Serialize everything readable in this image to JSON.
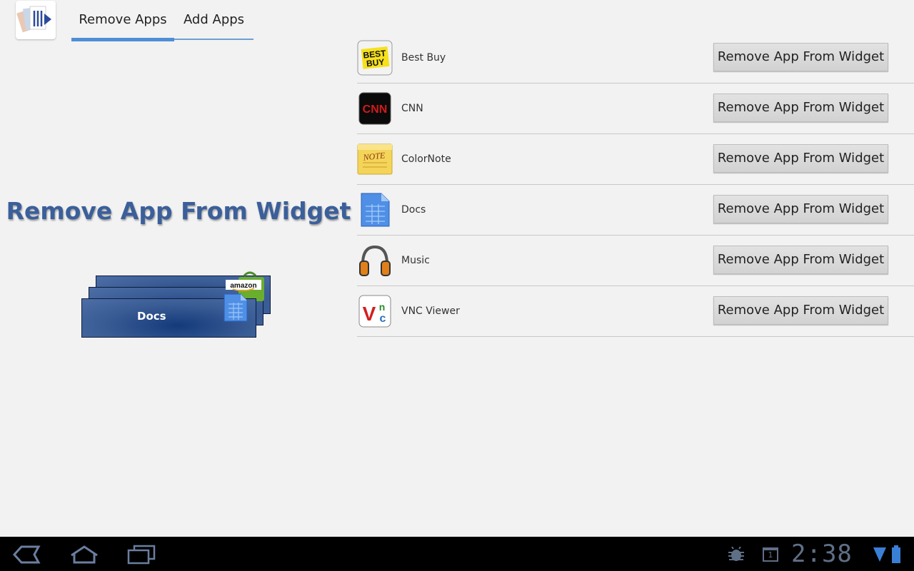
{
  "tabs": [
    {
      "label": "Remove Apps",
      "active": true
    },
    {
      "label": "Add Apps",
      "active": false
    }
  ],
  "promo": {
    "title": "Remove App From Widget",
    "card_label": "Docs",
    "mini_logo_text": "amazon"
  },
  "apps": [
    {
      "name": "Best Buy",
      "icon": "best-buy-icon",
      "button": "Remove App From Widget"
    },
    {
      "name": "CNN",
      "icon": "cnn-icon",
      "button": "Remove App From Widget"
    },
    {
      "name": "ColorNote",
      "icon": "colornote-icon",
      "button": "Remove App From Widget"
    },
    {
      "name": "Docs",
      "icon": "docs-icon",
      "button": "Remove App From Widget"
    },
    {
      "name": "Music",
      "icon": "music-icon",
      "button": "Remove App From Widget"
    },
    {
      "name": "VNC Viewer",
      "icon": "vnc-viewer-icon",
      "button": "Remove App From Widget"
    }
  ],
  "icon_text": {
    "bestbuy_line1": "BEST",
    "bestbuy_line2": "BUY",
    "cnn": "CNN",
    "note": "NOTE",
    "vnc_v": "V",
    "vnc_n": "n",
    "vnc_c": "c"
  },
  "status_bar": {
    "time": "2:38",
    "date_badge": "1"
  },
  "colors": {
    "accent": "#4d8fd6",
    "promo_title": "#3b5f9a",
    "background": "#f2f2f2",
    "system_bar": "#000000"
  }
}
